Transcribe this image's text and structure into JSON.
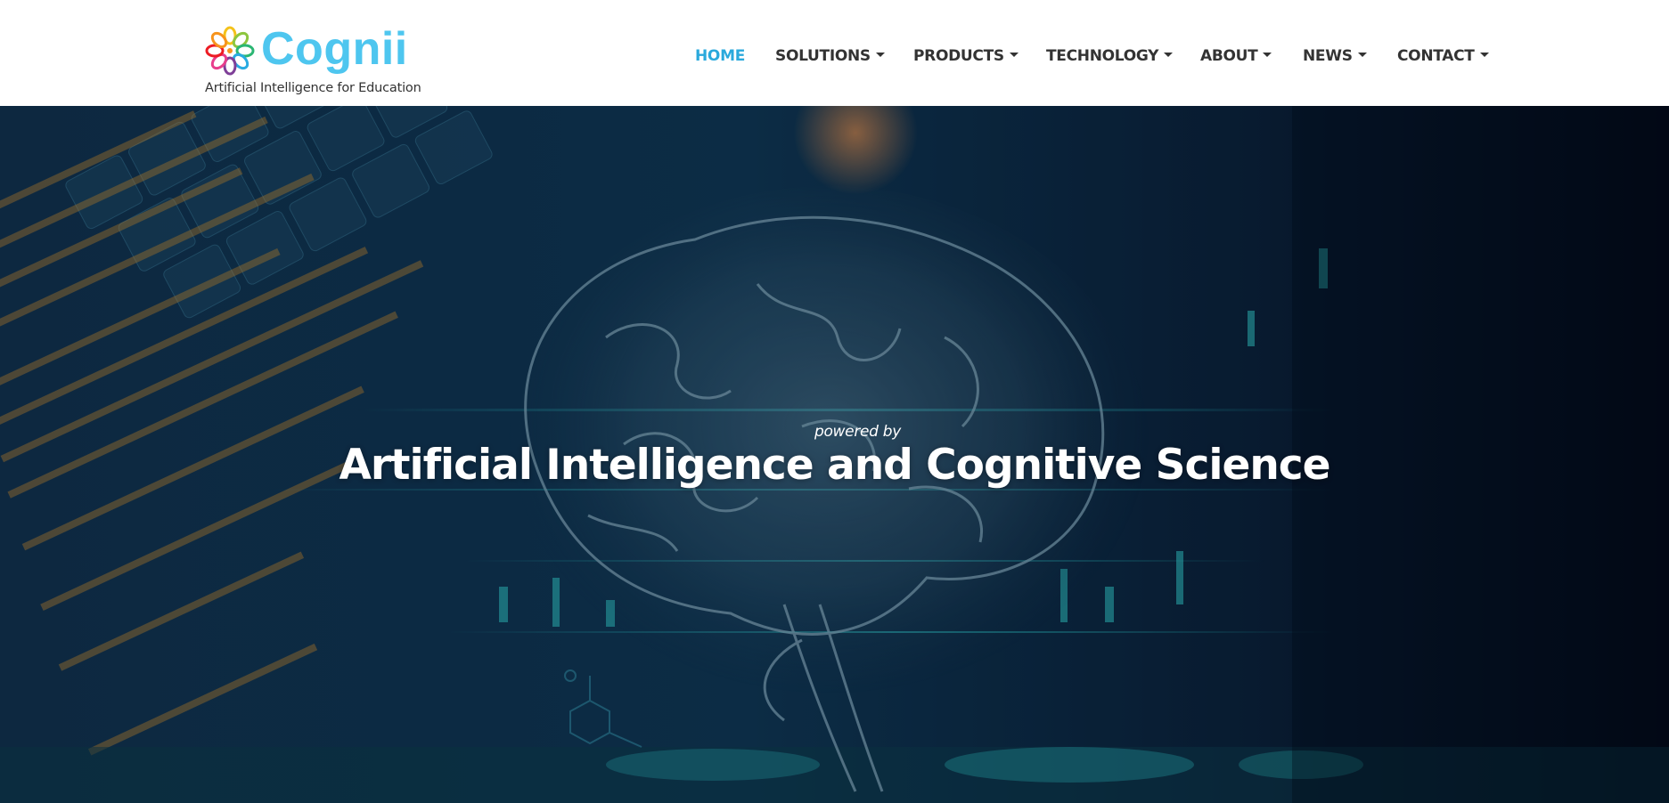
{
  "brand": {
    "name": "Cognii",
    "tagline": "Artificial Intelligence for Education",
    "accent_color": "#4ec6ef",
    "logo_icon": "spiral-flower-logo-icon"
  },
  "nav": {
    "items": [
      {
        "label": "HOME",
        "active": true,
        "dropdown": false
      },
      {
        "label": "SOLUTIONS",
        "active": false,
        "dropdown": true
      },
      {
        "label": "PRODUCTS",
        "active": false,
        "dropdown": true
      },
      {
        "label": "TECHNOLOGY",
        "active": false,
        "dropdown": true
      },
      {
        "label": "ABOUT",
        "active": false,
        "dropdown": true
      },
      {
        "label": "NEWS",
        "active": false,
        "dropdown": true
      },
      {
        "label": "CONTACT",
        "active": false,
        "dropdown": true
      }
    ],
    "active_color": "#2aa9dc",
    "text_color": "#333333"
  },
  "hero": {
    "kicker": "powered by",
    "headline": "Artificial Intelligence and Cognitive Science"
  }
}
